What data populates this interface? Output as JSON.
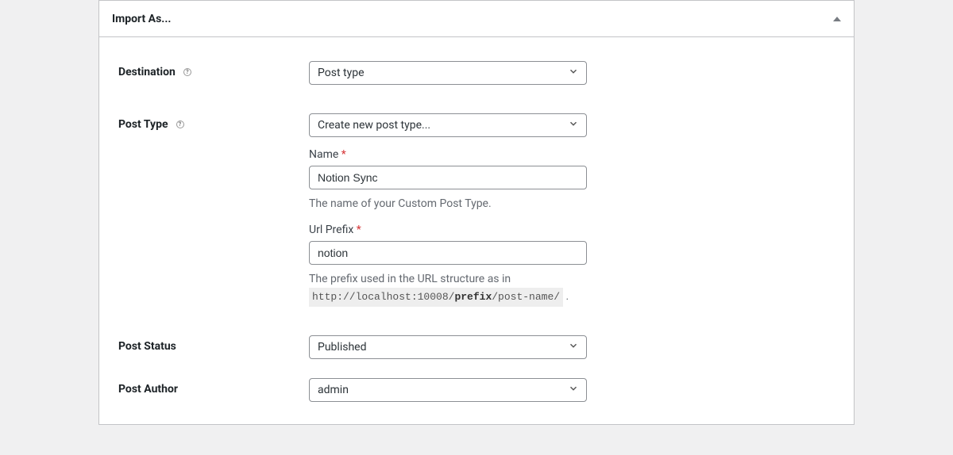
{
  "panel": {
    "title": "Import As..."
  },
  "fields": {
    "destination": {
      "label": "Destination",
      "value": "Post type"
    },
    "post_type": {
      "label": "Post Type",
      "value": "Create new post type...",
      "name_label": "Name ",
      "name_value": "Notion Sync",
      "name_help": "The name of your Custom Post Type.",
      "url_label": "Url Prefix ",
      "url_value": "notion",
      "url_help_prefix": "The prefix used in the URL structure as in ",
      "url_example_pre": "http://localhost:10008/",
      "url_example_bold": "prefix",
      "url_example_post": "/post-name/",
      "url_help_suffix": " ."
    },
    "post_status": {
      "label": "Post Status",
      "value": "Published"
    },
    "post_author": {
      "label": "Post Author",
      "value": "admin"
    }
  },
  "required_marker": "*"
}
